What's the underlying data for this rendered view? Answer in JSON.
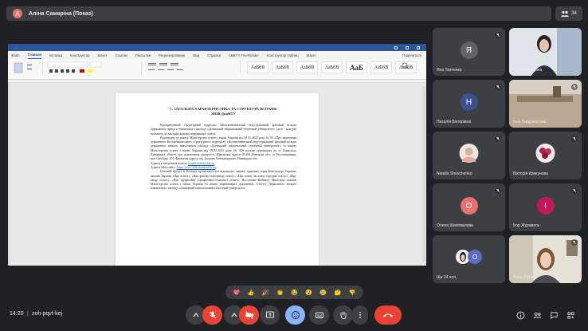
{
  "meeting": {
    "presenter_title": "Аліна Самаріна (Показ)",
    "presenter_initial": "А",
    "participants_count": "34",
    "time": "14:20",
    "separator": "|",
    "code": "zoh-pqvf-kej"
  },
  "word": {
    "title": "...",
    "tabs": [
      "Файл",
      "Главная",
      "Вставка",
      "Конструктор",
      "Макет",
      "Ссылки",
      "Рассылки",
      "Рецензирование",
      "Вид",
      "Справка",
      "ABBYY FineReader",
      "Конструктор таблиц",
      "Макет"
    ],
    "active_tab": 1,
    "share_label": "Поделиться",
    "styles": [
      {
        "sample": "АаБбВ",
        "big": false
      },
      {
        "sample": "АаБбВ",
        "big": false
      },
      {
        "sample": "АаБбВ",
        "big": false
      },
      {
        "sample": "АаБбВ",
        "big": false
      },
      {
        "sample": "АаБ",
        "big": true
      },
      {
        "sample": "АаБбВ",
        "big": false
      },
      {
        "sample": "АаБбВ",
        "big": false
      }
    ],
    "doc_heading_1": "1. ЗАГАЛЬНА ХАРАКТЕРИСТИКА ТА СТРУКТУРА ВСП КФК",
    "doc_heading_2": "ЗНЗВ ДонНТУ",
    "doc_paragraphs": [
      "Відокремлений структурний підрозділ «Костянтинівський індустріальний фаховий коледж Державного вищого навчального закладу «Донецький національний технічний університет» (далі - коледж) належить до закладів фахової передвищої освіти.",
      "Відповідно до наказу Міністерства освіти і науки України від 30.01.2023 року № 93 «Про закінчення державного Костянтинівського структурного підрозділу «Костянтинівський індустріальний фаховий коледж державного вищого навчального закладу «Донецький національний технічний університет» та наказу Міністерства освіти і науки України від 09.05.2023 року № 456 коледж переведено до м. Бориспіль Вінницької області, про поновлення діяльності. Юридична адреса: 85100 Донецька обл., м. Костянтинівка, вул. Свободи, 361. Фактична адреса: пр. Богдана Хмельницького, Вінницька обл.",
      "Адреса електронної пошти:",
      "Адреса Web-сайту:",
      "Освітній процес в Коледжі організовується відповідно чинних правових норм Конституції України, законів України «Про освіту», «Про фахову передвищу освіту», «Про повну загальну середню освіту», «Про вищу освіту», «Про професійну (професійно-технічну) освіту», Постанови Кабінету Міністрів, наказів Міністерства освіти і науки України та інших нормативних документів. Статуту Державного вищого навчального закладу «Донецький національний технічний університет»."
    ],
    "email_link": "kvnz@donntu.edu.ua",
    "web_link": "https://www.kifk.donntu.edu.ua"
  },
  "participants": [
    {
      "name": "Яна Ткаченко",
      "initial": "Я",
      "color": "#5f6368",
      "muted": true
    },
    {
      "name": "Аліна Самаріна",
      "initial": "",
      "color": "",
      "muted": false
    },
    {
      "name": "Наталія Вікторівна",
      "initial": "Н",
      "color": "#3c4f8f",
      "muted": true
    },
    {
      "name": "Інна Бардакасова",
      "initial": "",
      "color": "",
      "muted": true
    },
    {
      "name": "Natalia Shevchenko",
      "initial": "",
      "color": "",
      "muted": true
    },
    {
      "name": "Вікторія Крикунова",
      "initial": "",
      "color": "",
      "muted": true
    },
    {
      "name": "Олена Шаповалова",
      "initial": "О",
      "color": "#e8716f",
      "muted": true
    },
    {
      "name": "Ігор Журавель",
      "initial": "І",
      "color": "#c2185b",
      "muted": true
    },
    {
      "name": "Ще 24 чол.",
      "initial": "",
      "color": "",
      "muted": false
    },
    {
      "name": "Анна Ярмак",
      "initial": "",
      "color": "",
      "muted": true
    }
  ],
  "reactions": [
    "💖",
    "👍",
    "🎉",
    "👏",
    "😂",
    "😮",
    "😢",
    "🤔",
    "👎"
  ],
  "controls": {
    "mic_muted": true,
    "end_call_label": "end-call"
  }
}
